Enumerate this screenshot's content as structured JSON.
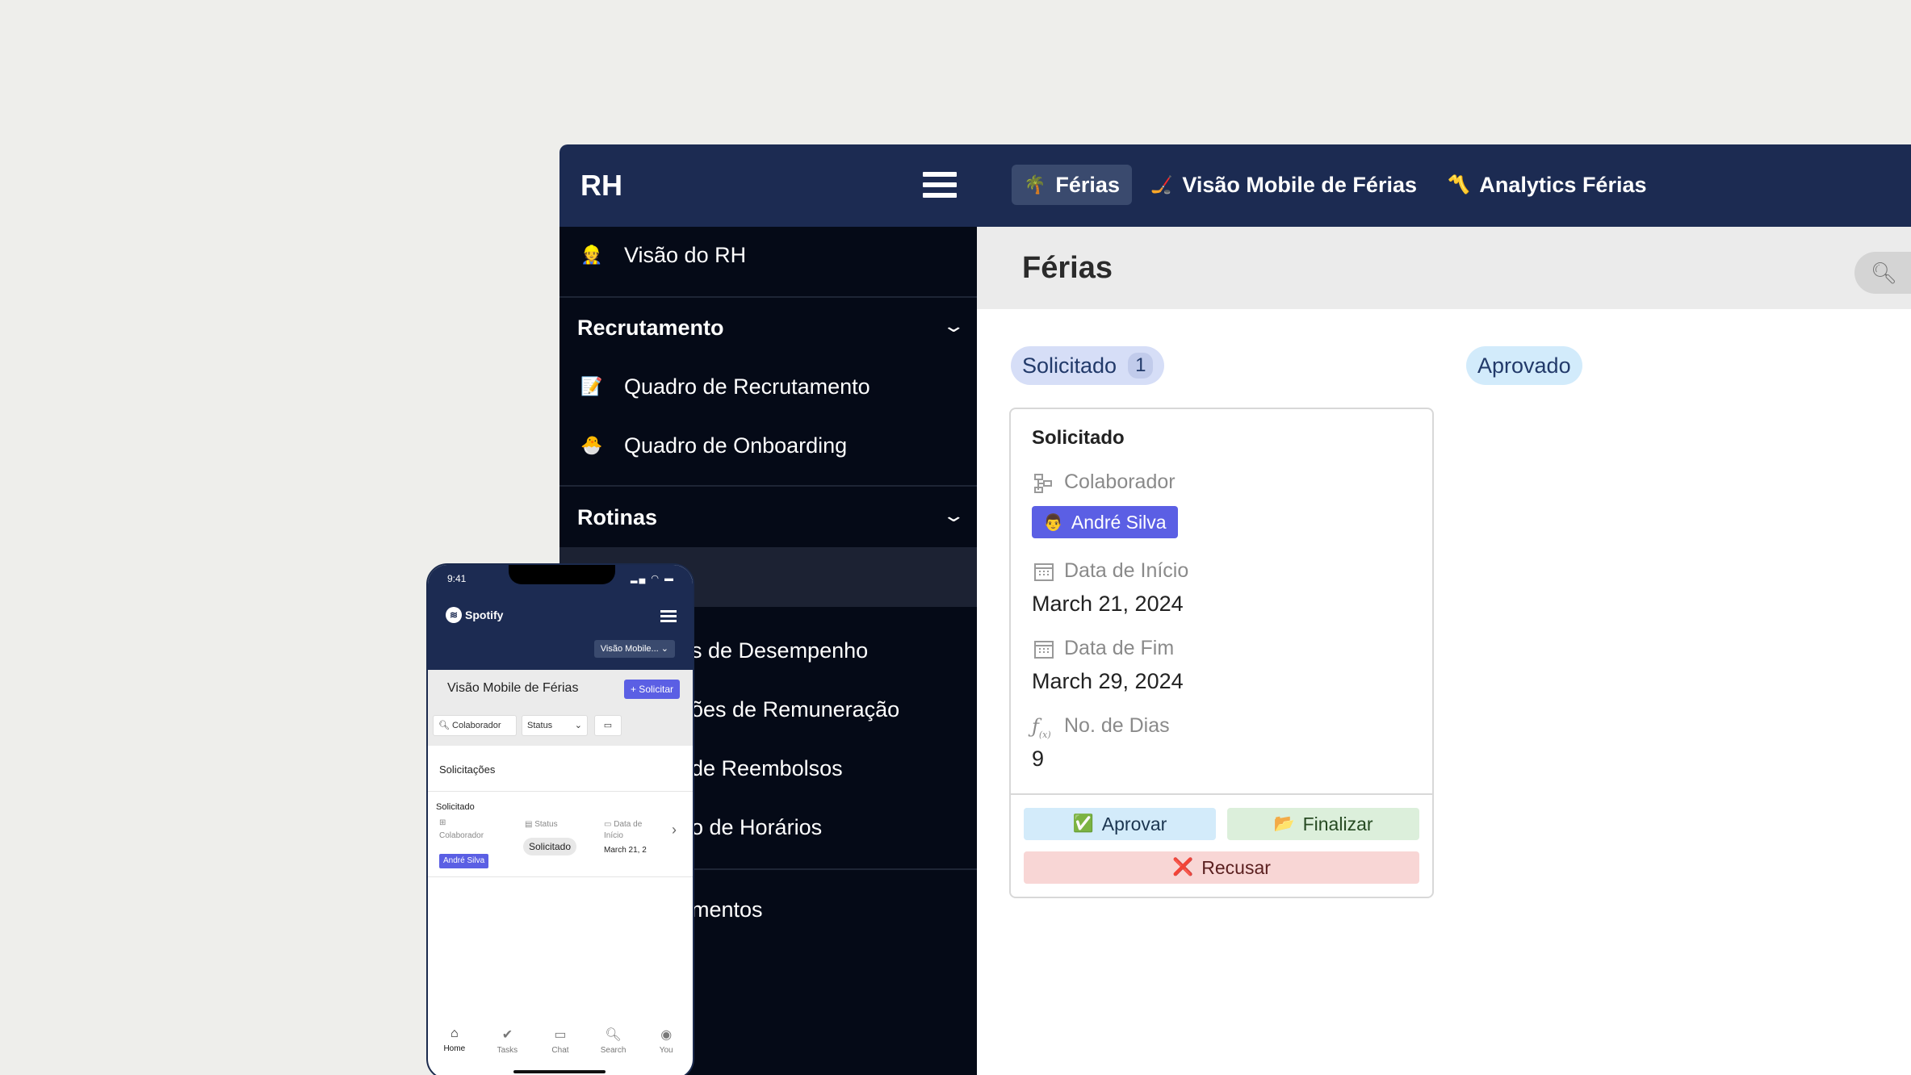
{
  "topbar": {
    "brand": "RH",
    "tabs": [
      {
        "label": "Férias",
        "icon": "🌴"
      },
      {
        "label": "Visão Mobile de Férias",
        "icon": "🏒"
      },
      {
        "label": "Analytics Férias",
        "icon": "〽️"
      }
    ]
  },
  "sidebar": {
    "top_item": {
      "label": "Visão do RH",
      "icon": "👷"
    },
    "sections": [
      {
        "title": "Recrutamento",
        "items": [
          {
            "label": "Quadro de Recrutamento",
            "icon": "📝"
          },
          {
            "label": "Quadro de Onboarding",
            "icon": "🐣"
          }
        ]
      },
      {
        "title": "Rotinas",
        "items": [
          {
            "label": "s de Desempenho"
          },
          {
            "label": "ões de Remuneração"
          },
          {
            "label": " de Reembolsos"
          },
          {
            "label": "o de Horários"
          }
        ]
      }
    ],
    "bottom_item": "mentos"
  },
  "main": {
    "title": "Férias",
    "columns": [
      {
        "label": "Solicitado",
        "count": "1"
      },
      {
        "label": "Aprovado"
      }
    ],
    "card": {
      "title": "Solicitado",
      "colaborador_label": "Colaborador",
      "colaborador_value": "André Silva",
      "colaborador_icon": "👨",
      "inicio_label": "Data de Início",
      "inicio_value": "March 21, 2024",
      "fim_label": "Data de Fim",
      "fim_value": "March 29, 2024",
      "dias_label": "No. de Dias",
      "dias_value": "9",
      "btn_aprovar": "Aprovar",
      "btn_aprovar_icon": "✅",
      "btn_finalizar": "Finalizar",
      "btn_finalizar_icon": "📂",
      "btn_recusar": "Recusar",
      "btn_recusar_icon": "❌"
    }
  },
  "phone": {
    "time": "9:41",
    "logo": "Spotify",
    "view_select": "Visão Mobile...",
    "title": "Visão Mobile de Férias",
    "request_btn": "+ Solicitar",
    "filter_colab": "Colaborador",
    "filter_status": "Status",
    "section": "Solicitações",
    "group": "Solicitado",
    "col_colab": "Colaborador",
    "col_status": "Status",
    "col_data_a": "Data de",
    "col_data_b": "Início",
    "chip": "André Silva",
    "status": "Solicitado",
    "date": "March 21, 2",
    "nav": [
      "Home",
      "Tasks",
      "Chat",
      "Search",
      "You"
    ]
  },
  "colors": {
    "navy": "#1c2b52",
    "sidebar": "#050a17",
    "accent": "#5b5fe4"
  }
}
